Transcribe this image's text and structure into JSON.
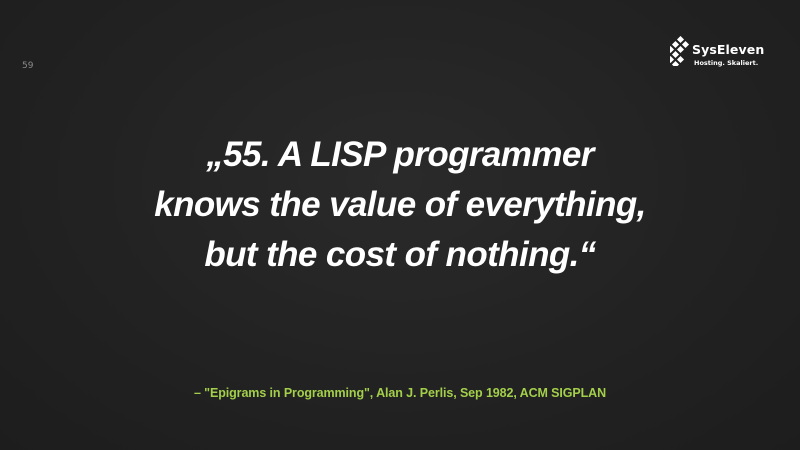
{
  "slide": {
    "number": "59"
  },
  "logo": {
    "name": "SysEleven",
    "tagline": "Hosting. Skaliert.",
    "color": "#ffffff"
  },
  "quote": {
    "lines": [
      "„55. A LISP programmer",
      "knows the value of everything,",
      "but the cost of nothing.“"
    ],
    "color": "#ffffff"
  },
  "citation": {
    "text": "– \"Epigrams in Programming\", Alan J. Perlis, Sep 1982, ACM SIGPLAN",
    "color": "#a3cf4a"
  },
  "background_color": "#222222"
}
